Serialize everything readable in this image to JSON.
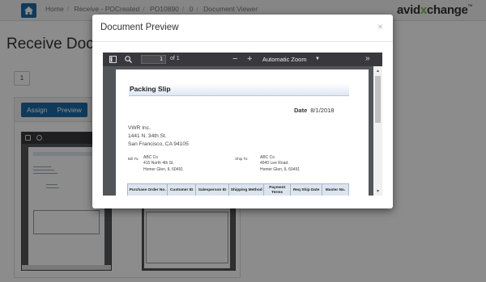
{
  "nav": {
    "breadcrumbs": [
      "Home",
      "Receive - POCreated",
      "PO10890",
      "0",
      "Document Viewer"
    ],
    "separator": "/",
    "logo_main": "avid",
    "logo_x": "x",
    "logo_rest": "change",
    "logo_tm": "TM"
  },
  "background": {
    "page_title": "Receive Docu",
    "pager_value": "1",
    "assign_label": "Assign",
    "preview_label": "Preview"
  },
  "modal": {
    "title": "Document Preview",
    "close_glyph": "×"
  },
  "viewer": {
    "page_number": "1",
    "page_count_text": "of 1",
    "zoom_minus": "−",
    "zoom_plus": "+",
    "zoom_value": "Automatic Zoom",
    "more_glyph": "»"
  },
  "document": {
    "title": "Packing Slip",
    "date_label": "Date",
    "date_value": "8/1/2018",
    "vendor_lines": [
      "VWR Inc.",
      "1441 N. 34th St.",
      "San Francisco, CA 94105"
    ],
    "bill_to_label": "Bill To:",
    "bill_to_lines": [
      "ABC Co",
      "415 North 4th St.",
      "Homer Glen, IL 60491"
    ],
    "ship_to_label": "Ship To:",
    "ship_to_lines": [
      "ABC Co",
      "4940 Lee Road.",
      "Homer Glen, IL 60491"
    ],
    "table_headers": [
      "Purchase Order No.",
      "Customer ID",
      "Salesperson ID",
      "Shipping Method",
      "Payment Terms",
      "Req Ship Date",
      "Master No."
    ]
  },
  "colors": {
    "primary": "#1c6aa6",
    "logo_accent": "#7ab648",
    "viewer_bg": "#525659",
    "viewer_toolbar": "#38383d"
  }
}
